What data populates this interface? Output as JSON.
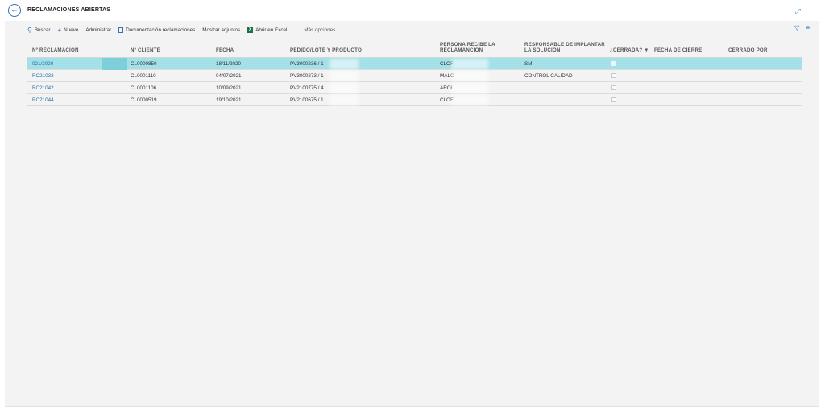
{
  "page": {
    "title": "RECLAMACIONES ABIERTAS"
  },
  "actions": {
    "search": "Buscar",
    "new": "Nuevo",
    "manage": "Administrar",
    "documentation": "Documentación reclamaciones",
    "attachments": "Mostrar adjuntos",
    "excel": "Abrir en Excel",
    "more": "Más opciones"
  },
  "icons": {
    "back": "back-arrow-icon",
    "expand": "expand-icon",
    "search": "search-icon",
    "new": "plus-icon",
    "doc": "document-icon",
    "excel": "excel-icon",
    "filter": "filter-icon",
    "list": "list-icon"
  },
  "colors": {
    "selected_row": "#a3e0e8",
    "link": "#1f6fa8",
    "accent": "#3a6fb0"
  },
  "table": {
    "headers": {
      "n_reclamacion": "Nº RECLAMACIÓN",
      "n_cliente": "Nº CLIENTE",
      "fecha": "FECHA",
      "pedido": "PEDIDO/LOTE Y PRODUCTO",
      "persona": "PERSONA RECIBE LA RECLAMANCIÓN",
      "responsable": "RESPONSABLE DE IMPLANTAR LA SOLUCIÓN",
      "cerrada": "¿CERRADA? ▼",
      "fecha_cierre": "FECHA DE CIERRE",
      "cerrado_por": "CERRADO POR"
    },
    "rows": [
      {
        "reclamacion": "021/2020",
        "cliente": "CL0000850",
        "fecha": "18/11/2020",
        "pedido": "PV3000236 / 1",
        "persona": "CLOF",
        "responsable": "SM",
        "cerrada": false,
        "fecha_cierre": "",
        "cerrado_por": "",
        "selected": true
      },
      {
        "reclamacion": "RC21033",
        "cliente": "CL0001110",
        "fecha": "04/07/2021",
        "pedido": "PV3000273 / 1",
        "persona": "MALC",
        "responsable": "CONTROL CALIDAD",
        "cerrada": false,
        "fecha_cierre": "",
        "cerrado_por": "",
        "selected": false
      },
      {
        "reclamacion": "RC21042",
        "cliente": "CL0001106",
        "fecha": "10/09/2021",
        "pedido": "PV2100775 / 4",
        "persona": "AROI",
        "responsable": "",
        "cerrada": false,
        "fecha_cierre": "",
        "cerrado_por": "",
        "selected": false
      },
      {
        "reclamacion": "RC21044",
        "cliente": "CL0000519",
        "fecha": "19/10/2021",
        "pedido": "PV2100675 / 1",
        "persona": "CLOF",
        "responsable": "",
        "cerrada": false,
        "fecha_cierre": "",
        "cerrado_por": "",
        "selected": false
      }
    ]
  }
}
